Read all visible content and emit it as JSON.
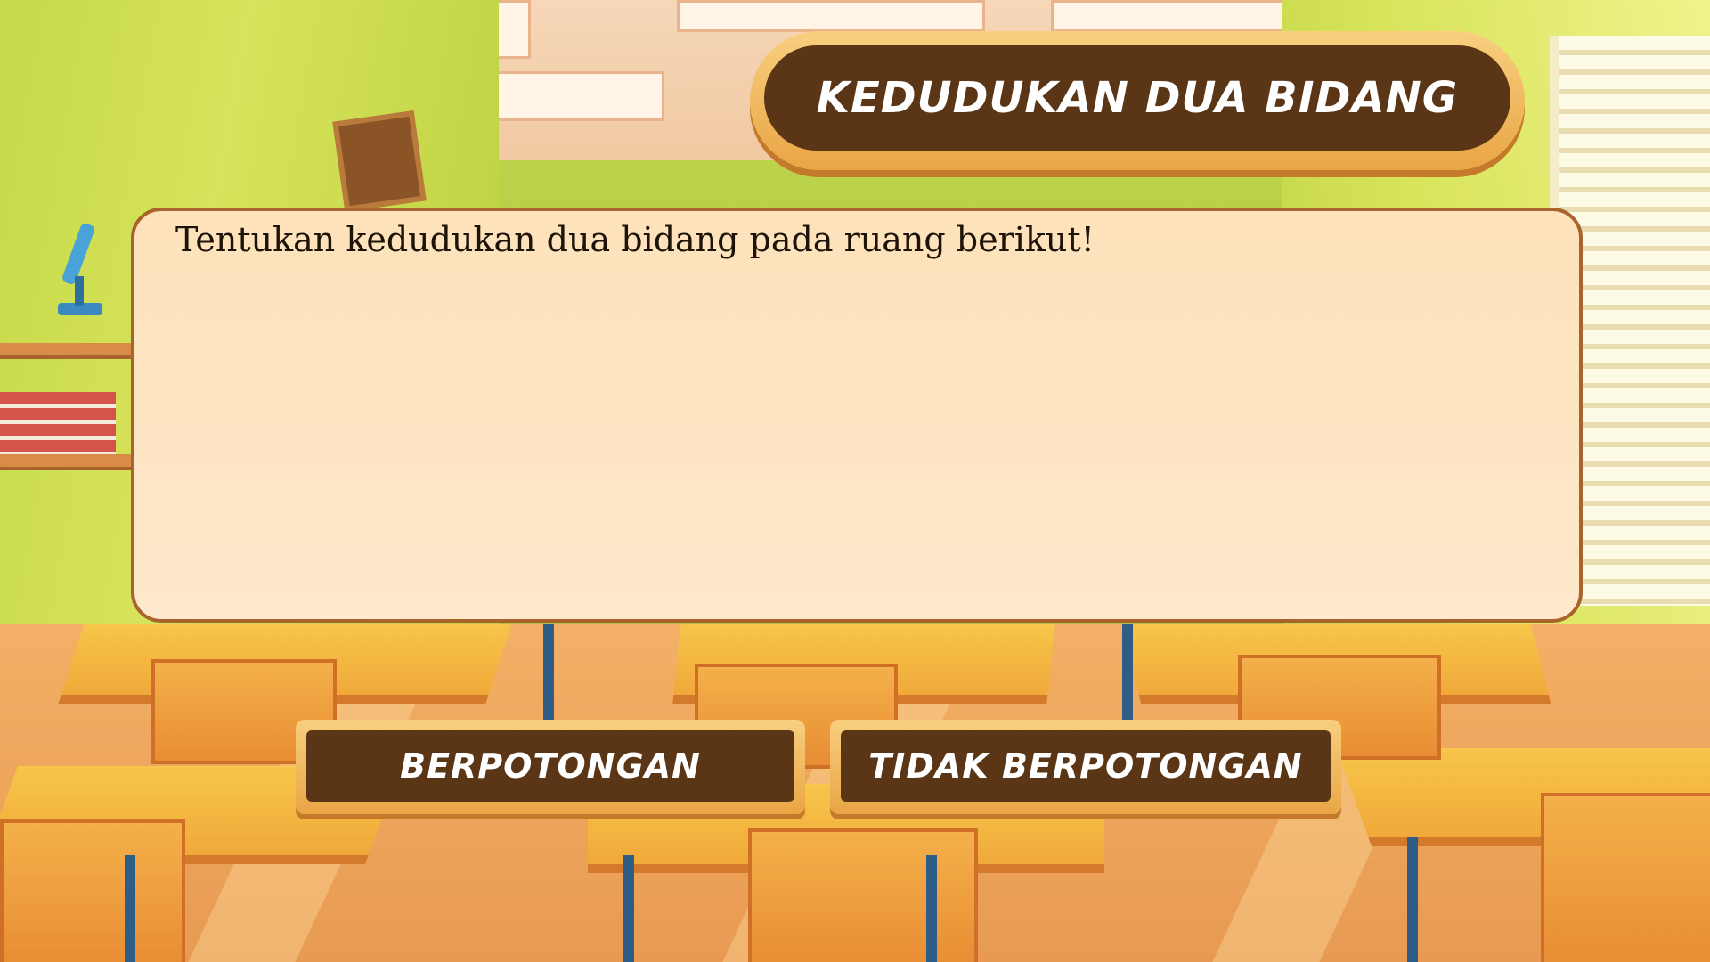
{
  "header": {
    "title": "KEDUDUKAN DUA BIDANG"
  },
  "question": {
    "text": "Tentukan kedudukan dua bidang pada ruang berikut!"
  },
  "answers": [
    {
      "label": "BERPOTONGAN"
    },
    {
      "label": "TIDAK BERPOTONGAN"
    }
  ],
  "colors": {
    "banner_fill": "#5a3516",
    "banner_border": "#f0b95f",
    "panel_fill": "#fee6c4",
    "panel_border": "#a8642c"
  }
}
